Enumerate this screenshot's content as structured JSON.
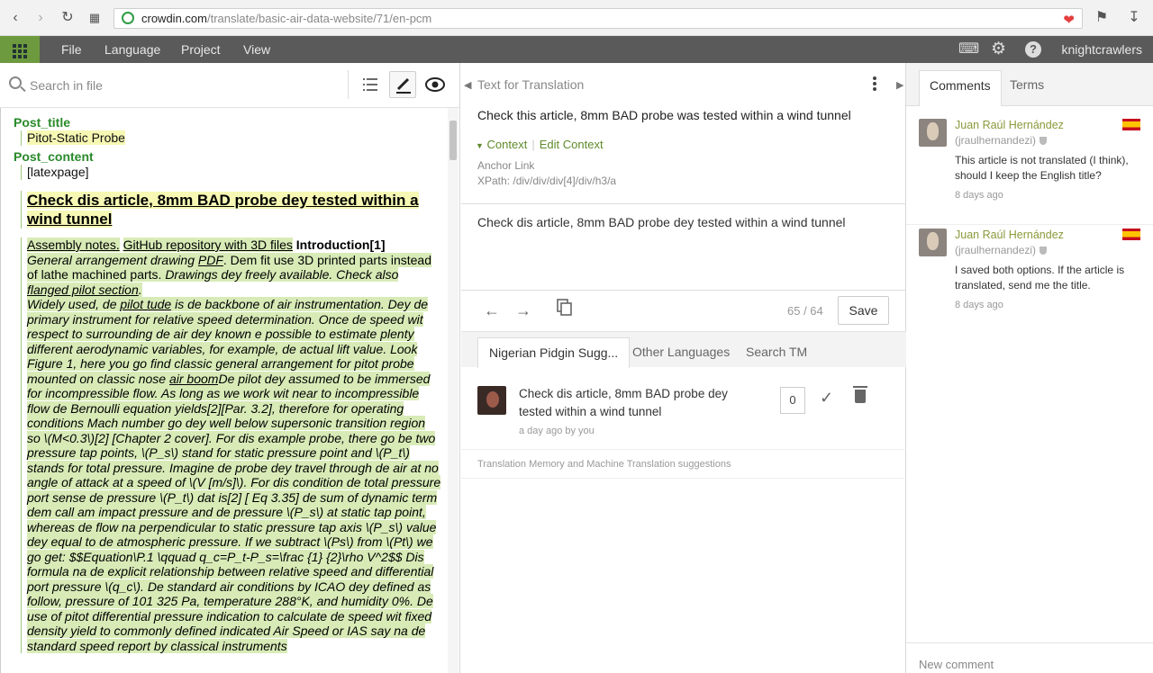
{
  "browser": {
    "url_domain": "crowdin.com",
    "url_path": "/translate/basic-air-data-website/71/en-pcm"
  },
  "menu": {
    "items": [
      "File",
      "Language",
      "Project",
      "View"
    ],
    "username": "knightcrawlers"
  },
  "left": {
    "search_placeholder": "Search in file",
    "strings": [
      {
        "key": "Post_title",
        "value": "Pitot-Static Probe"
      },
      {
        "key": "Post_content",
        "value": "[latexpage]"
      }
    ],
    "heading": "Check dis article, 8mm BAD probe dey tested within a wind tunnel",
    "links": [
      "Assembly notes.",
      "GitHub repository with 3D files"
    ],
    "intro": "Introduction[1]",
    "body": {
      "p1a": "General arrangement drawing ",
      "pdf": "PDF",
      "p1b": ". Dem fit use 3D printed parts instead of lathe machined parts. ",
      "p1c": "Drawings dey freely available. Check also ",
      "flanged": "flanged pilot section",
      "p1d": ".",
      "p2a": "Widely used, de ",
      "pilot": "pilot tude",
      "p2b": " is de backbone of air instrumentation. Dey de primary instrument for relative speed determination. Once de speed wit respect to surrounding de air dey known e possible to estimate plenty different aerodynamic variables, for example, de actual lift value. Look Figure 1, here you go find classic general arrangement for pitot probe mounted on classic nose ",
      "boom": "air boom",
      "p2c": "De pilot dey assumed to be immersed for incompressible flow. As long as we work wit near to incompressible flow de Bernoulli equation yields[2][Par. 3.2], therefore for operating conditions Mach number go dey well below supersonic transition region so \\(M<0.3\\)[2] [Chapter 2 cover]. For dis example probe, there go be two pressure tap points, \\(P_s\\) stand for static pressure point and \\(P_t\\) stands for total pressure. Imagine de probe dey travel through de air at no angle of attack at a speed of \\(V [m/s]\\). For dis condition de total pressure port sense de pressure \\(P_t\\) dat is[2] [ Eq 3.35]  de sum of dynamic term dem call am impact pressure and de pressure \\(P_s\\) at static tap point, whereas de flow na perpendicular to static pressure tap axis \\(P_s\\) value dey equal to de atmospheric pressure. If we subtract \\(Ps\\) from \\(Pt\\) we go get: $$Equation\\P.1 \\qquad q_c=P_t-P_s=\\frac {1} {2}\\rho V^2$$ Dis formula na de explicit relationship between relative speed and differential port pressure \\(q_c\\). De standard air conditions by ICAO dey defined as follow, pressure of 101 325 Pa, temperature 288°K, and humidity 0%. De use of pitot differential pressure indication to calculate de speed wit fixed density yield to commonly defined indicated Air Speed or IAS say na de standard speed report by classical instruments"
    }
  },
  "mid": {
    "source_label": "Text for Translation",
    "source_text": "Check this article, 8mm BAD probe was tested within a wind tunnel",
    "context_label": "Context",
    "edit_context_label": "Edit Context",
    "anchor": "Anchor Link",
    "xpath": "XPath: /div/div/div[4]/div/h3/a",
    "translation_text": "Check dis article, 8mm BAD probe dey tested within a wind tunnel",
    "counter": "65 / 64",
    "save_label": "Save",
    "tabs": [
      "Nigerian Pidgin Sugg...",
      "Other Languages",
      "Search TM"
    ],
    "suggestion": {
      "text": "Check dis article, 8mm BAD probe dey tested within a wind tunnel",
      "meta": "a day ago by you",
      "votes": "0"
    },
    "tm_label": "Translation Memory and Machine Translation suggestions"
  },
  "right": {
    "tabs": [
      "Comments",
      "Terms"
    ],
    "comments": [
      {
        "author": "Juan Raúl Hernández",
        "username": "(jraulhernandezi)",
        "text": "This article is not translated (I think), should I keep the English title?",
        "time": "8 days ago"
      },
      {
        "author": "Juan Raúl Hernández",
        "username": "(jraulhernandezi)",
        "text": "I saved both options. If the article is translated, send me the title.",
        "time": "8 days ago"
      }
    ],
    "new_comment_placeholder": "New comment"
  },
  "colors": {
    "menubar": "#5a5a5a",
    "accent_green": "#6e9a3f",
    "translated_bg": "#d8ebb7",
    "heading_bg": "#f6f8b4"
  }
}
